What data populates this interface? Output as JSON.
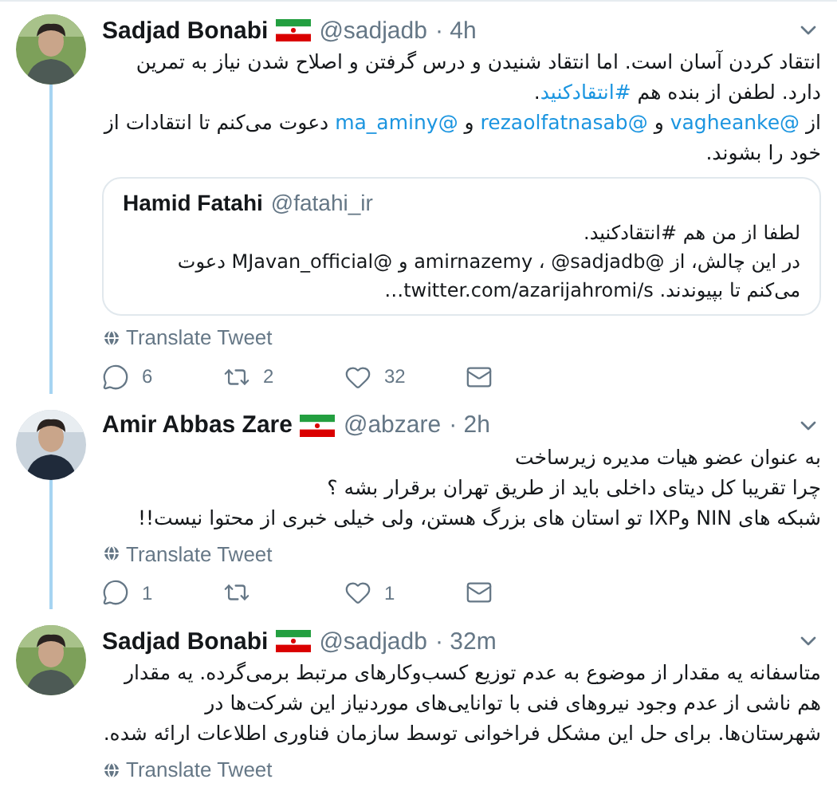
{
  "tweets": [
    {
      "name": "Sadjad Bonabi",
      "handle": "@sadjadb",
      "time": "· 4h",
      "connected": true,
      "lines": [
        [
          {
            "kind": "text",
            "text": "انتقاد کردن آسان است. اما انتقاد شنیدن و درس گرفتن و اصلاح شدن نیاز به تمرین"
          }
        ],
        [
          {
            "kind": "text",
            "text": "دارد. لطفن از بنده هم "
          },
          {
            "kind": "link",
            "text": "#انتقادکنید"
          },
          {
            "kind": "text",
            "text": "."
          }
        ],
        [
          {
            "kind": "text",
            "text": "از "
          },
          {
            "kind": "link",
            "text": "@vagheanke"
          },
          {
            "kind": "text",
            "text": " و "
          },
          {
            "kind": "link",
            "text": "@rezaolfatnasab"
          },
          {
            "kind": "text",
            "text": " و "
          },
          {
            "kind": "link",
            "text": "@ma_aminy"
          },
          {
            "kind": "text",
            "text": " دعوت می‌کنم تا انتقادات از"
          }
        ],
        [
          {
            "kind": "text",
            "text": "خود را بشوند."
          }
        ]
      ],
      "quote": {
        "name": "Hamid Fatahi",
        "handle": "@fatahi_ir",
        "lines": [
          "لطفا از من هم  #انتقادکنید.",
          "در این چالش، از @amirnazemy ، @sadjadb  و @MJavan_official  دعوت",
          "می‌کنم تا بپیوندند. twitter.com/azarijahromi/s…"
        ]
      },
      "translate": "Translate Tweet",
      "actions": {
        "replies": "6",
        "retweets": "2",
        "likes": "32"
      }
    },
    {
      "name": "Amir Abbas Zare",
      "handle": "@abzare",
      "time": "· 2h",
      "connected": true,
      "lines": [
        [
          {
            "kind": "text",
            "text": "به عنوان عضو هیات مدیره زیرساخت"
          }
        ],
        [
          {
            "kind": "text",
            "text": "چرا تقریبا کل دیتای داخلی باید از طریق تهران برقرار بشه ؟"
          }
        ],
        [
          {
            "kind": "text",
            "text": "شبکه های NIN وIXP تو استان های بزرگ هستن، ولی خیلی خبری از محتوا نیست!!"
          }
        ]
      ],
      "translate": "Translate Tweet",
      "actions": {
        "replies": "1",
        "likes": "1"
      }
    },
    {
      "name": "Sadjad Bonabi",
      "handle": "@sadjadb",
      "time": "· 32m",
      "connected": false,
      "lines": [
        [
          {
            "kind": "text",
            "text": "متاسفانه یه مقدار از موضوع به عدم توزیع کسب‌وکارهای مرتبط برمی‌گرده. یه مقدار"
          }
        ],
        [
          {
            "kind": "text",
            "text": "هم ناشی از عدم وجود نیروهای فنی با توانایی‌های موردنیاز این شرکت‌ها در"
          }
        ],
        [
          {
            "kind": "text",
            "text": "شهرستان‌ها. برای حل این مشکل فراخوانی توسط سازمان فناوری اطلاعات ارائه شده."
          }
        ]
      ],
      "translate": "Translate Tweet"
    }
  ]
}
